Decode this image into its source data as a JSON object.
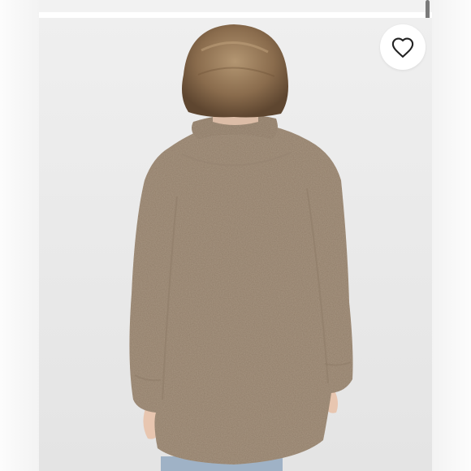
{
  "listing": {
    "photo_alt": "",
    "like_icon": "heart-outline-icon",
    "colors": {
      "background": "#ebebeb",
      "garment": "#a89682",
      "hair": "#8a6c4d",
      "jeans": "#9fb2c6",
      "icon": "#222222"
    }
  }
}
